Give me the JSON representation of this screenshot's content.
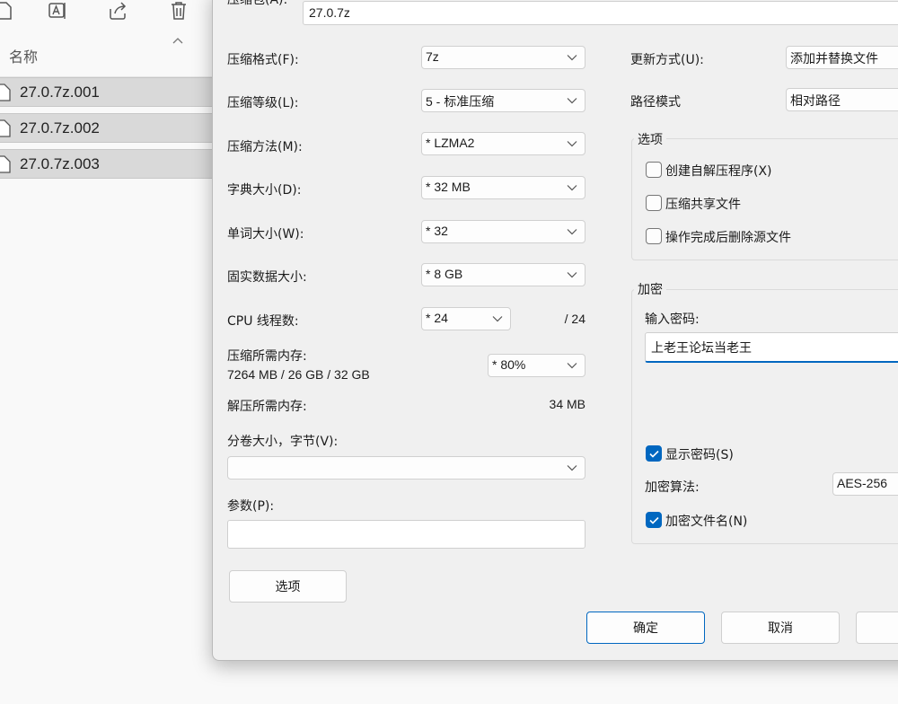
{
  "explorer": {
    "toolbar": {
      "icons": [
        "file-icon",
        "rename-icon",
        "share-icon",
        "delete-icon"
      ]
    },
    "column_header": "名称",
    "files": [
      {
        "name": "27.0.7z.001"
      },
      {
        "name": "27.0.7z.002"
      },
      {
        "name": "27.0.7z.003"
      }
    ]
  },
  "dialog": {
    "archive_label": "压缩包(A):",
    "archive_value": "27.0.7z",
    "left": {
      "format_label": "压缩格式(F):",
      "format_value": "7z",
      "level_label": "压缩等级(L):",
      "level_value": "5 - 标准压缩",
      "method_label": "压缩方法(M):",
      "method_value": "* LZMA2",
      "dict_label": "字典大小(D):",
      "dict_value": "* 32 MB",
      "word_label": "单词大小(W):",
      "word_value": "* 32",
      "solid_label": "固实数据大小:",
      "solid_value": "* 8 GB",
      "cpu_label": "CPU 线程数:",
      "cpu_value": "* 24",
      "cpu_total": "/ 24",
      "mem_compress_label": "压缩所需内存:",
      "mem_compress_detail": "7264 MB / 26 GB / 32 GB",
      "mem_percent_value": "* 80%",
      "mem_decompress_label": "解压所需内存:",
      "mem_decompress_value": "34 MB",
      "split_label": "分卷大小，字节(V):",
      "split_value": "",
      "params_label": "参数(P):",
      "params_value": "",
      "options_button": "选项"
    },
    "right": {
      "update_label": "更新方式(U):",
      "update_value": "添加并替换文件",
      "path_label": "路径模式",
      "path_value": "相对路径",
      "options_group": "选项",
      "opt_sfx": "创建自解压程序(X)",
      "opt_sfx_checked": false,
      "opt_shared": "压缩共享文件",
      "opt_shared_checked": false,
      "opt_delete": "操作完成后删除源文件",
      "opt_delete_checked": false,
      "encrypt_group": "加密",
      "password_label": "输入密码:",
      "password_value": "上老王论坛当老王",
      "show_password": "显示密码(S)",
      "show_password_checked": true,
      "enc_method_label": "加密算法:",
      "enc_method_value": "AES-256",
      "enc_names": "加密文件名(N)",
      "enc_names_checked": true
    },
    "buttons": {
      "ok": "确定",
      "cancel": "取消",
      "help": ""
    },
    "accent_color": "#0067c0"
  }
}
